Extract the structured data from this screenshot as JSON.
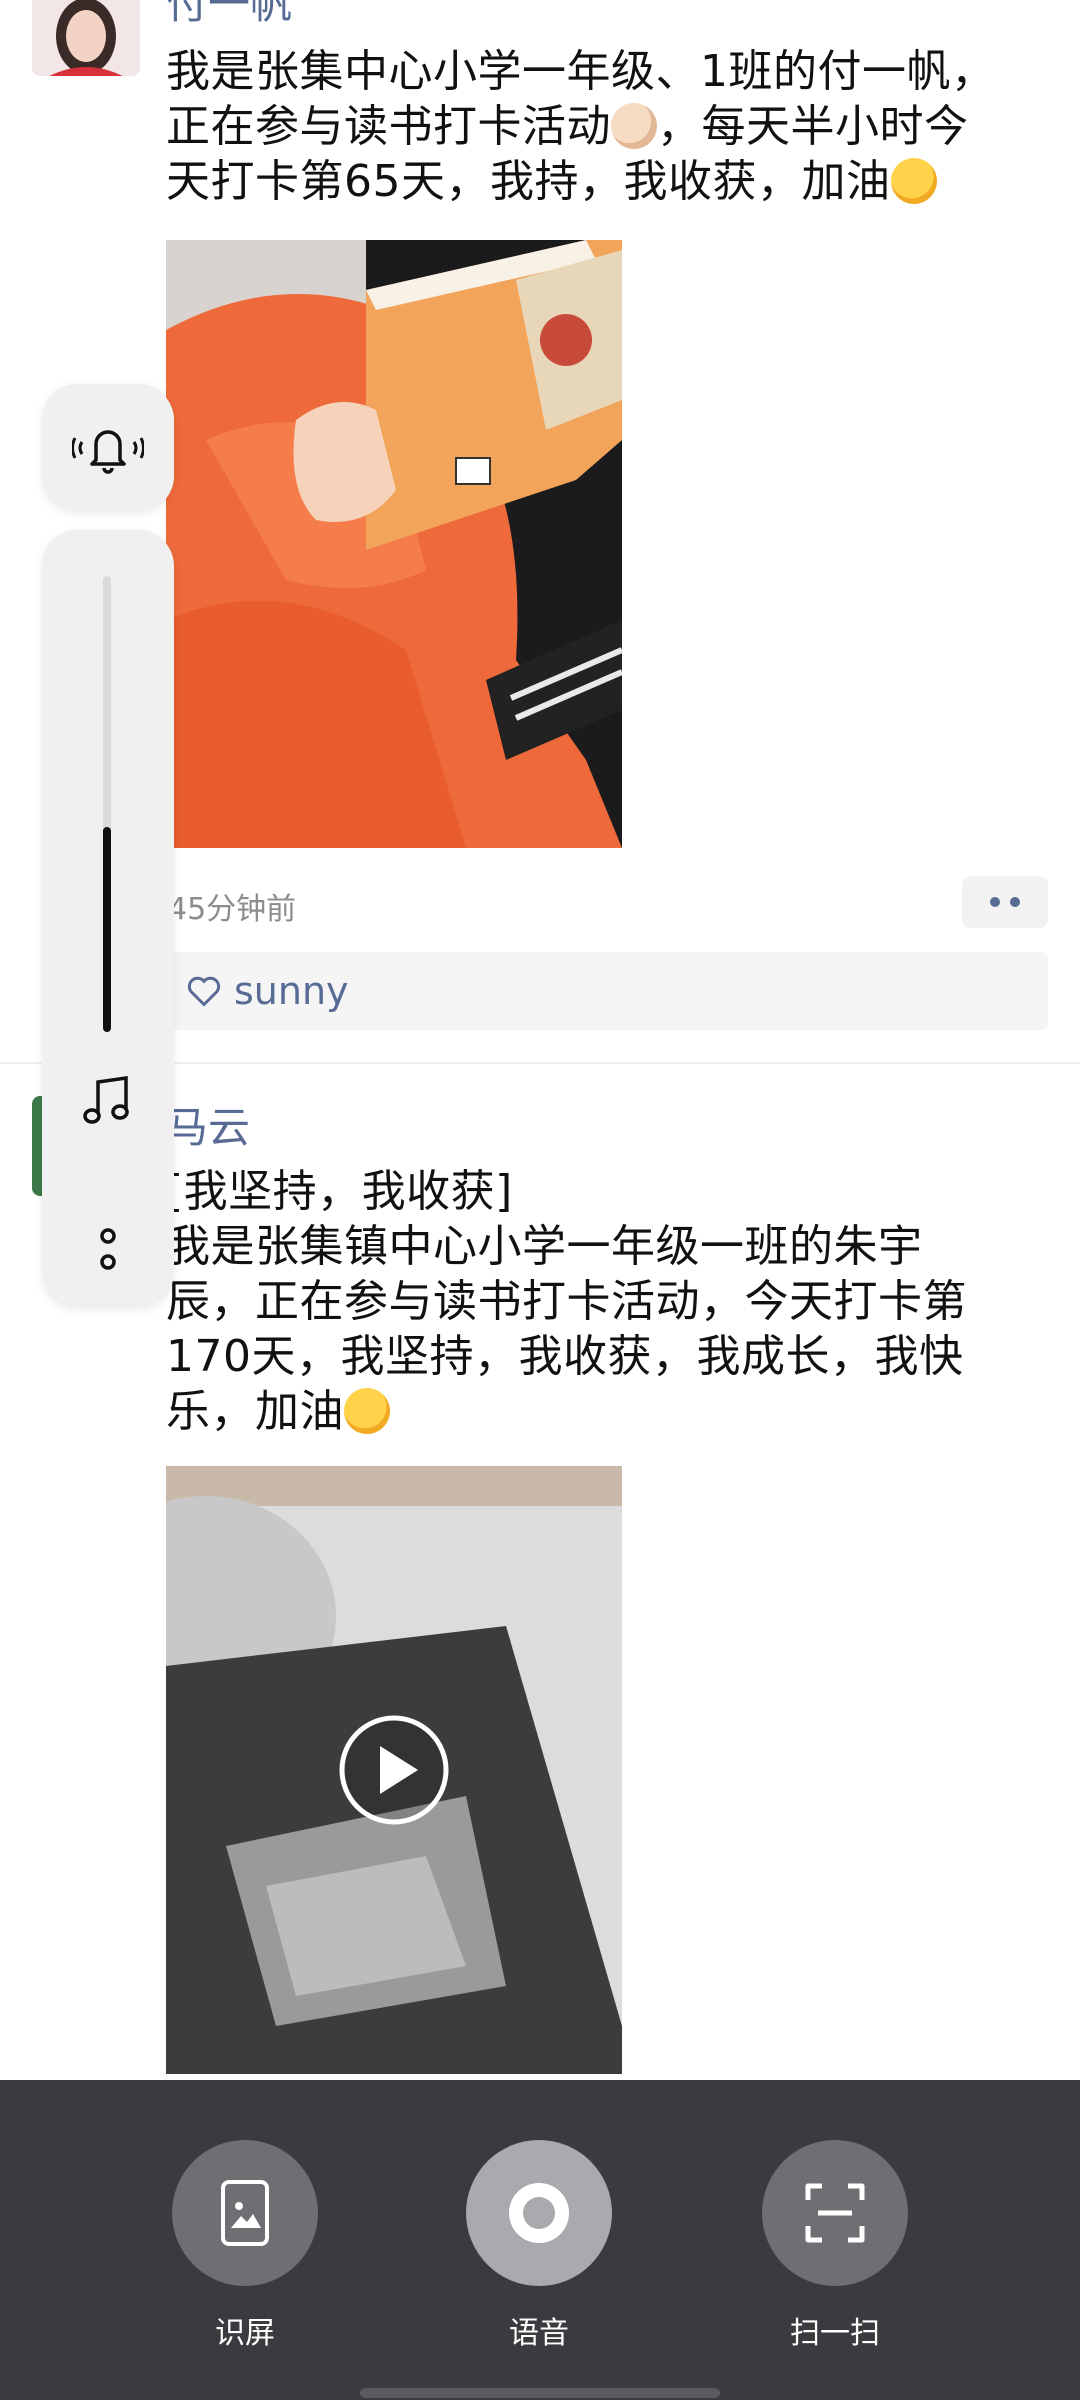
{
  "posts": [
    {
      "author": "付一帆",
      "text_lines": [
        "我是张集中心小学一年级、1班的付一帆，",
        "正在参与读书打卡活动",
        "，每天半小时今",
        "天打卡第65天，我持，我收获，加油"
      ],
      "emojis": [
        "clapping-hands",
        "raised-fist"
      ],
      "time": "45分钟前",
      "likes": [
        "sunny"
      ]
    },
    {
      "author": "马云",
      "text_lines": [
        "[我坚持，我收获]",
        "我是张集镇中心小学一年级一班的朱宇",
        "辰，正在参与读书打卡活动，今天打卡第",
        "170天，我坚持，我收获，我成长，我快",
        "乐，加油"
      ],
      "emojis": [
        "raised-fist"
      ],
      "media": "video"
    }
  ],
  "sidebar": {
    "icons": [
      "bell-icon",
      "music-note-icon",
      "more-vertical-icon"
    ],
    "volume_level": 0.45
  },
  "bottom_panel": {
    "tools": [
      {
        "label": "识屏",
        "icon": "screen-recognize-icon"
      },
      {
        "label": "语音",
        "icon": "voice-icon"
      },
      {
        "label": "扫一扫",
        "icon": "scan-icon"
      }
    ]
  }
}
